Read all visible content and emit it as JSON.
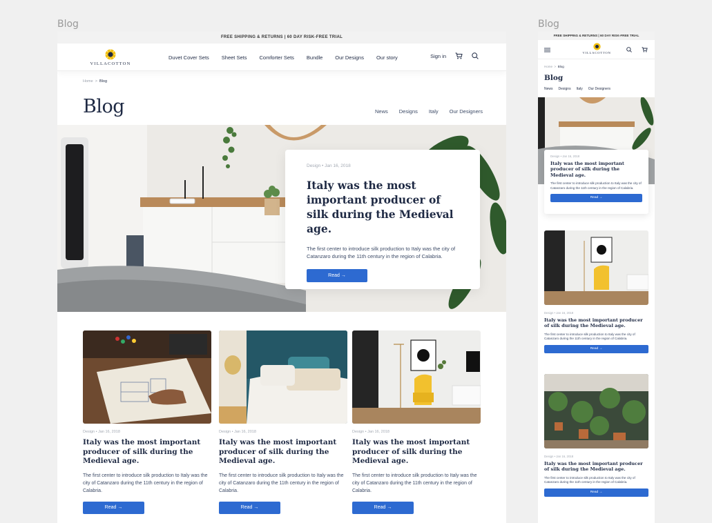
{
  "labels": {
    "desktop": "Blog",
    "mobile": "Blog"
  },
  "announcement": "FREE SHIPPING & RETURNS | 60 DAY RISK-FREE TRIAL",
  "brand": "VILLACOTTON",
  "menu": [
    "Duvet Cover Sets",
    "Sheet Sets",
    "Comforter Sets",
    "Bundle",
    "Our Designs",
    "Our story"
  ],
  "signin": "Sign in",
  "breadcrumb": {
    "home": "Home",
    "sep": ">",
    "current": "Blog"
  },
  "page_title": "Blog",
  "categories": [
    "News",
    "Designs",
    "Italy",
    "Our Designers"
  ],
  "post": {
    "meta": "Design  •  Jan 16, 2018",
    "title": "Italy was the most important producer of silk during the Medieval age.",
    "excerpt": "The first center to introduce silk production to Italy was the city of Catanzaro during the 11th century in the region of Calabria.",
    "read": "Read →"
  },
  "colors": {
    "accent": "#2d6ad1",
    "navy": "#1f2a44",
    "logo": "#f2c010"
  },
  "icons": [
    "cart-icon",
    "search-icon",
    "menu-icon"
  ]
}
